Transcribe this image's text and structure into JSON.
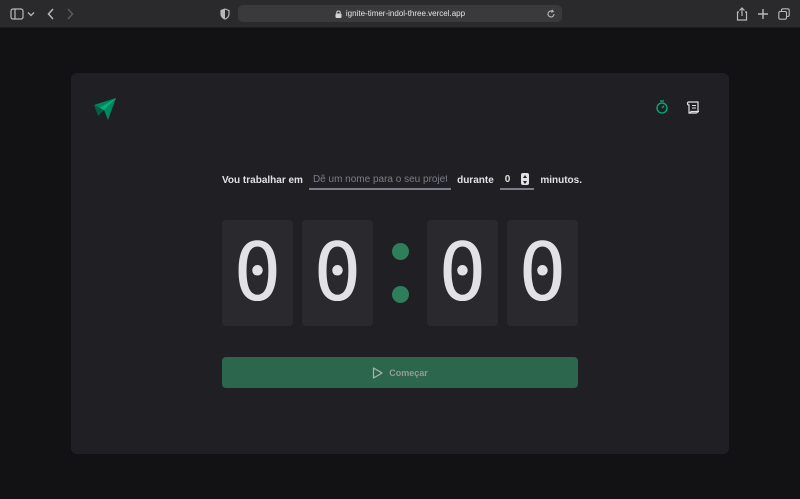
{
  "browser": {
    "url": "ignite-timer-indol-three.vercel.app"
  },
  "form": {
    "label_prefix": "Vou trabalhar em",
    "task_placeholder": "Dê um nome para o seu projeto",
    "task_value": "",
    "label_during": "durante",
    "minutes_value": "0",
    "label_suffix": "minutos."
  },
  "countdown": {
    "minutes_tens": "0",
    "minutes_ones": "0",
    "seconds_tens": "0",
    "seconds_ones": "0"
  },
  "start_button": {
    "label": "Começar"
  },
  "colors": {
    "accent": "#00875f",
    "button": "#2d6a4f",
    "card": "#202024",
    "background": "#121214",
    "digit_bg": "#29292e",
    "text": "#e1e1e6"
  },
  "icons": {
    "logo": "ignite-logo-icon",
    "nav_timer": "timer-icon",
    "nav_history": "scroll-icon",
    "button": "play-icon"
  }
}
